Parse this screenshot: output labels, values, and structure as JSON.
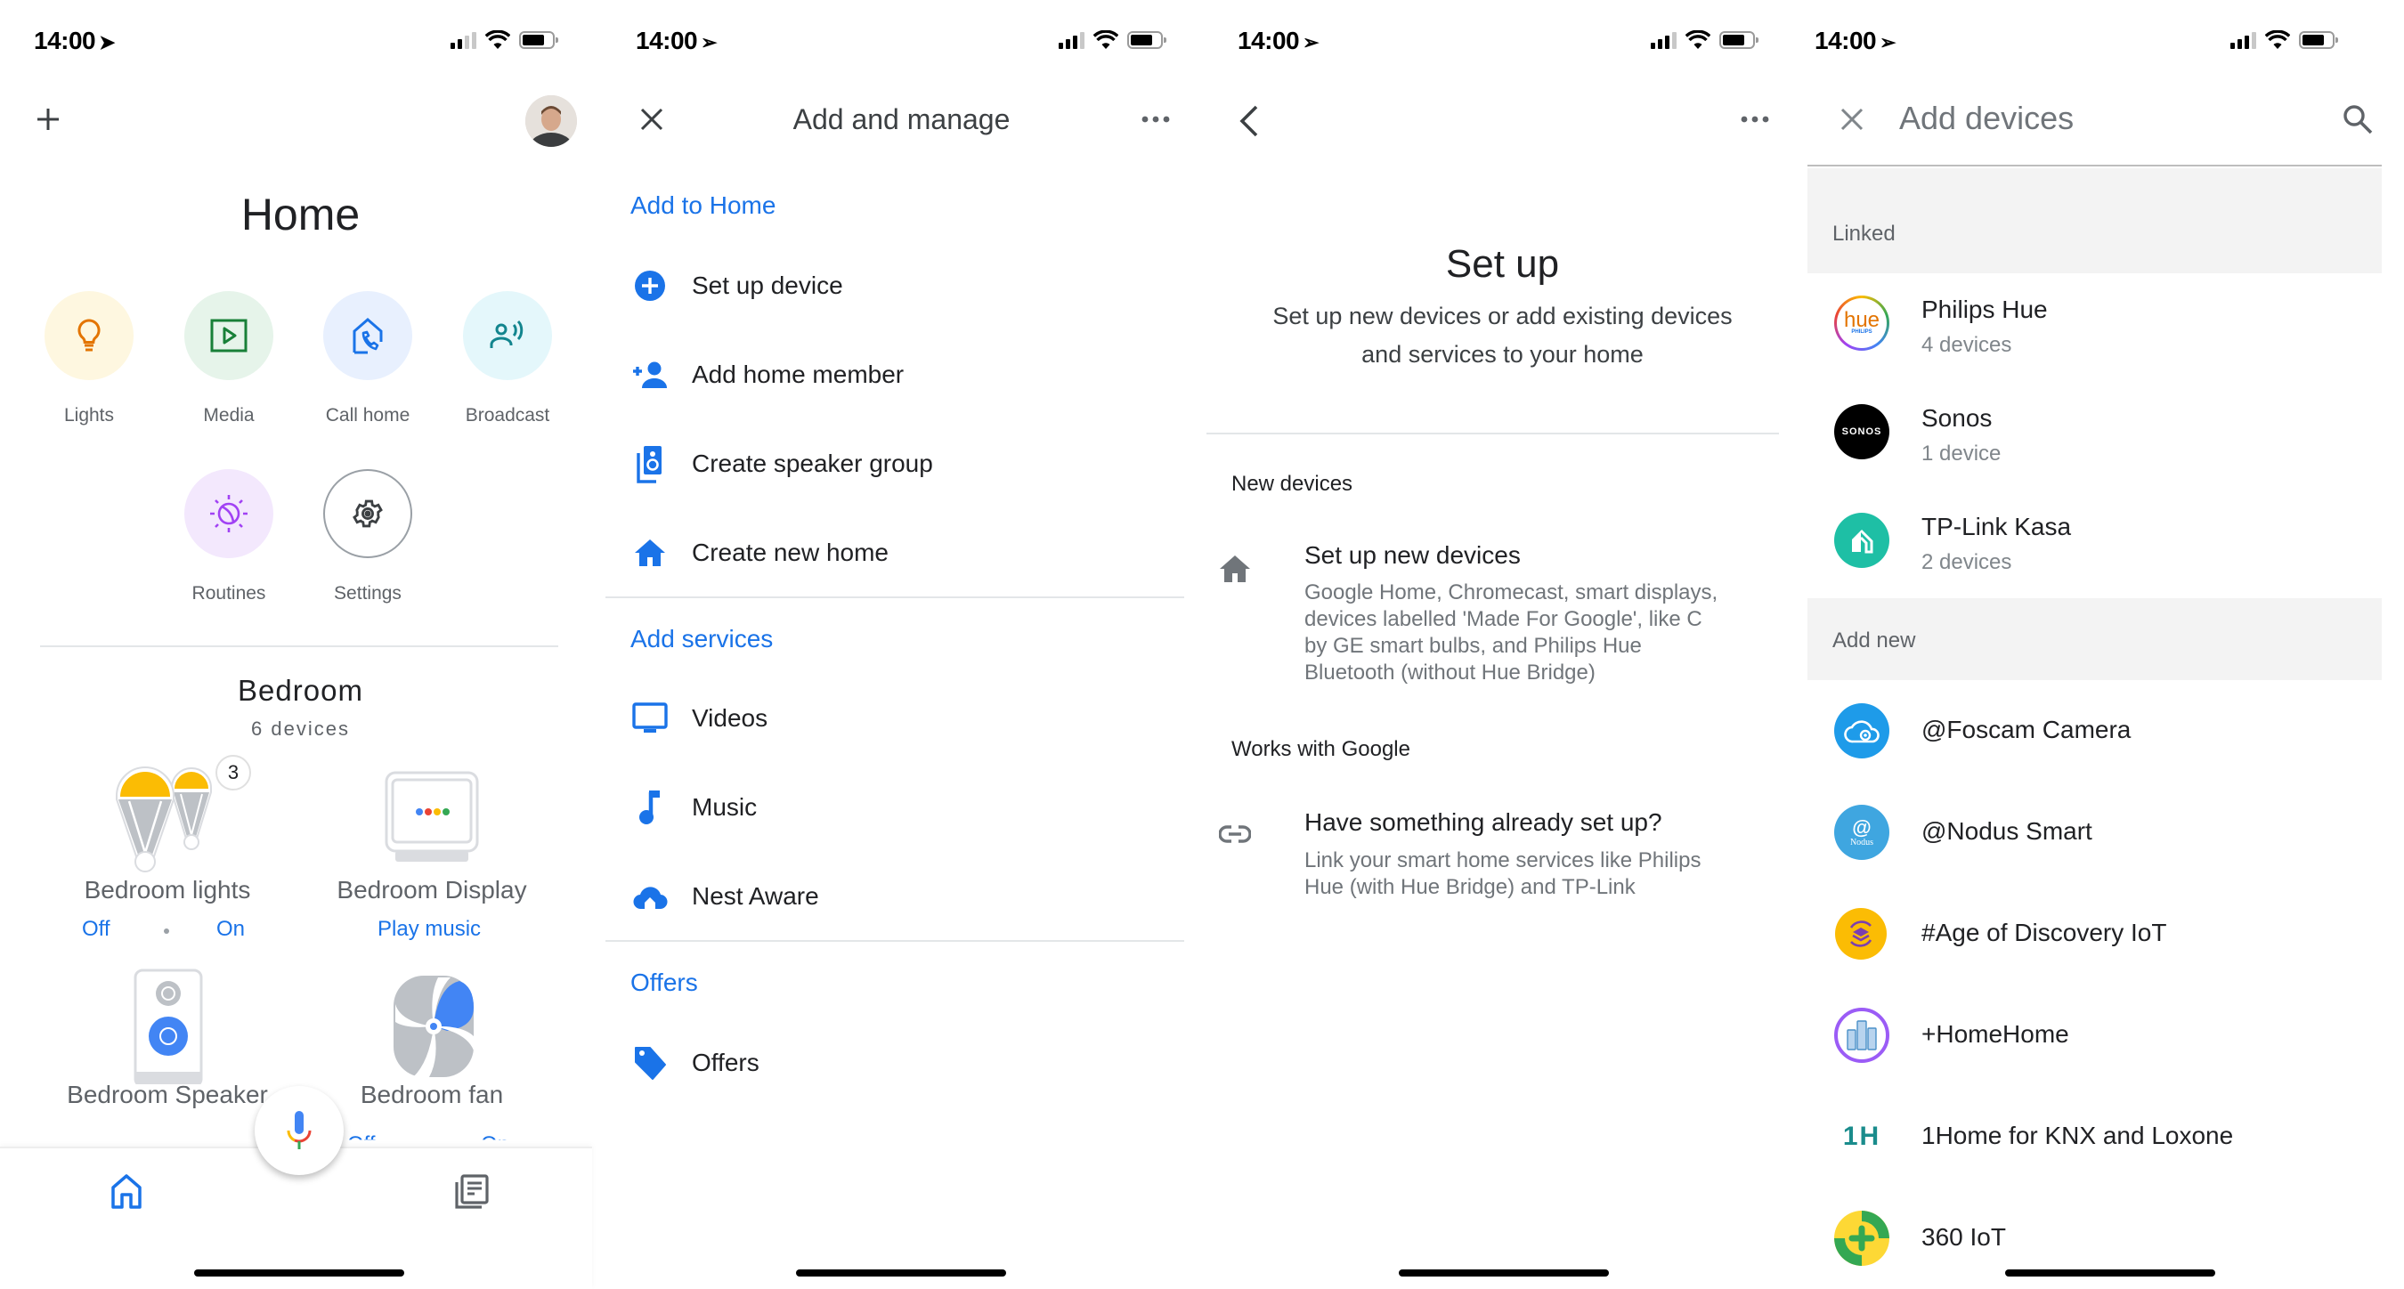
{
  "status_bar": {
    "time": "14:00",
    "location_arrow": "location-arrow-icon"
  },
  "screen_home": {
    "add_icon": "plus-icon",
    "title": "Home",
    "quick_actions": [
      {
        "label": "Lights",
        "icon": "lightbulb-icon",
        "bg": "#fef7e0",
        "fg": "#e37400"
      },
      {
        "label": "Media",
        "icon": "play-media-icon",
        "bg": "#e6f4ea",
        "fg": "#188038"
      },
      {
        "label": "Call home",
        "icon": "call-home-icon",
        "bg": "#e8f0fe",
        "fg": "#1a73e8"
      },
      {
        "label": "Broadcast",
        "icon": "broadcast-icon",
        "bg": "#e4f7fb",
        "fg": "#12858e"
      },
      {
        "label": "Routines",
        "icon": "routines-icon",
        "bg": "#f3e8fd",
        "fg": "#a142f4"
      },
      {
        "label": "Settings",
        "icon": "gear-icon",
        "bg": "#ffffff",
        "fg": "#5f6368"
      }
    ],
    "room": {
      "name": "Bedroom",
      "device_count": "6 devices",
      "devices": [
        {
          "name": "Bedroom lights",
          "badge": "3",
          "actions": [
            "Off",
            "On"
          ]
        },
        {
          "name": "Bedroom Display",
          "actions": [
            "Play music"
          ]
        },
        {
          "name": "Bedroom Speaker"
        },
        {
          "name": "Bedroom fan",
          "actions": [
            "Off",
            "On"
          ]
        }
      ]
    },
    "bottom_nav": [
      {
        "name": "home-tab",
        "icon": "home-icon",
        "active": true
      },
      {
        "name": "feed-tab",
        "icon": "feed-icon",
        "active": false
      }
    ]
  },
  "screen_add_manage": {
    "title": "Add and manage",
    "sections": [
      {
        "header": "Add to Home",
        "items": [
          {
            "label": "Set up device",
            "icon": "add-circle-icon"
          },
          {
            "label": "Add home member",
            "icon": "person-add-icon"
          },
          {
            "label": "Create speaker group",
            "icon": "speaker-group-icon"
          },
          {
            "label": "Create new home",
            "icon": "home-icon"
          }
        ]
      },
      {
        "header": "Add services",
        "items": [
          {
            "label": "Videos",
            "icon": "tv-icon"
          },
          {
            "label": "Music",
            "icon": "music-note-icon"
          },
          {
            "label": "Nest Aware",
            "icon": "nest-aware-icon"
          }
        ]
      },
      {
        "header": "Offers",
        "items": [
          {
            "label": "Offers",
            "icon": "tag-icon"
          }
        ]
      }
    ]
  },
  "screen_set_up": {
    "title": "Set up",
    "subtitle_line1": "Set up new devices or add existing devices",
    "subtitle_line2": "and services to your home",
    "new_devices": {
      "header": "New devices",
      "item_title": "Set up new devices",
      "item_desc": [
        "Google Home, Chromecast, smart displays,",
        "devices labelled 'Made For Google', like C",
        "by GE smart bulbs, and Philips Hue",
        "Bluetooth (without Hue Bridge)"
      ]
    },
    "works_with_google": {
      "header": "Works with Google",
      "item_title": "Have something already set up?",
      "item_desc": [
        "Link your smart home services like Philips",
        "Hue (with Hue Bridge) and TP-Link"
      ]
    }
  },
  "screen_add_devices": {
    "title": "Add devices",
    "linked_header": "Linked",
    "linked": [
      {
        "name": "Philips Hue",
        "count": "4 devices",
        "logo": "hue"
      },
      {
        "name": "Sonos",
        "count": "1 device",
        "logo": "SONOS"
      },
      {
        "name": "TP-Link Kasa",
        "count": "2 devices",
        "logo": "kasa"
      }
    ],
    "add_new_header": "Add new",
    "add_new": [
      {
        "name": "@Foscam Camera",
        "logo": "foscam"
      },
      {
        "name": "@Nodus Smart",
        "logo": "Nodus"
      },
      {
        "name": "#Age of Discovery IoT",
        "logo": "age"
      },
      {
        "name": "+HomeHome",
        "logo": "homehome"
      },
      {
        "name": "1Home for KNX and Loxone",
        "logo": "1H"
      },
      {
        "name": "360 IoT",
        "logo": "360"
      }
    ]
  },
  "colors": {
    "accent": "#1a73e8",
    "text_primary": "#202124",
    "text_secondary": "#5f6368",
    "band": "#f3f3f3"
  }
}
